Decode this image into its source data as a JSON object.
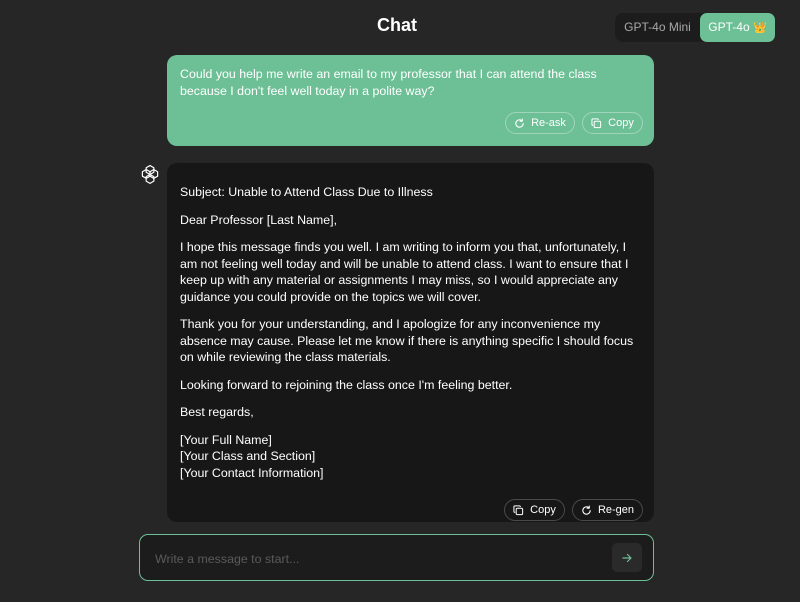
{
  "header": {
    "title": "Chat",
    "models": [
      {
        "label": "GPT-4o Mini",
        "selected": false
      },
      {
        "label": "GPT-4o",
        "badge": "👑",
        "selected": true
      }
    ]
  },
  "conversation": {
    "user_message": {
      "text": "Could you help me write an email to my professor that I can attend the class because I don't feel well today in a polite way?",
      "actions": {
        "reask": "Re-ask",
        "copy": "Copy"
      }
    },
    "assistant_message": {
      "paragraphs": [
        "Subject: Unable to Attend Class Due to Illness",
        "Dear Professor [Last Name],",
        "I hope this message finds you well. I am writing to inform you that, unfortunately, I am not feeling well today and will be unable to attend class. I want to ensure that I keep up with any material or assignments I may miss, so I would appreciate any guidance you could provide on the topics we will cover.",
        "Thank you for your understanding, and I apologize for any inconvenience my absence may cause. Please let me know if there is anything specific I should focus on while reviewing the class materials.",
        "Looking forward to rejoining the class once I'm feeling better.",
        "Best regards,"
      ],
      "signature": [
        "[Your Full Name]",
        "[Your Class and Section]",
        "[Your Contact Information]"
      ],
      "actions": {
        "copy": "Copy",
        "regen": "Re-gen"
      }
    }
  },
  "composer": {
    "placeholder": "Write a message to start...",
    "value": ""
  },
  "colors": {
    "accent": "#6dbf96",
    "background": "#262626",
    "assistant_bubble": "#171717"
  }
}
